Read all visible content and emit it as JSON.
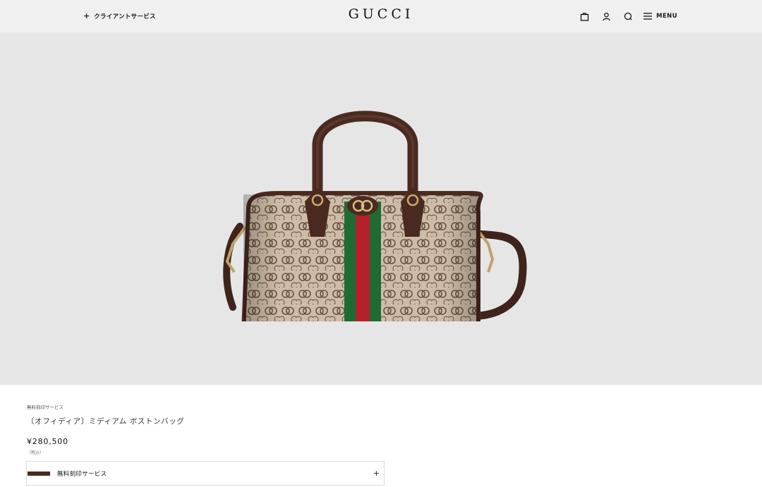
{
  "header": {
    "client_service_icon": "plus-icon",
    "client_service_label": "クライアントサービス",
    "logo": "GUCCI",
    "icons": [
      "shopping-bag-icon",
      "user-icon",
      "search-icon",
      "hamburger-menu-icon"
    ],
    "menu_label": "MENU"
  },
  "product": {
    "image_alt": "Ophidia GG Supreme medium boston bag",
    "promo": "無料刻印サービス",
    "title": "〔オフィディア〕ミディアム ボストンバッグ",
    "price": "¥280,500",
    "tax_note": "（税込）"
  },
  "service": {
    "label": "無料刻印サービス",
    "plus": "+"
  },
  "colors": {
    "header_bg": "#f0f0f0",
    "hero_bg": "#e6e6e6",
    "leather": "#4a2a20",
    "stripe_green": "#1f6b34",
    "stripe_red": "#b3212a"
  }
}
